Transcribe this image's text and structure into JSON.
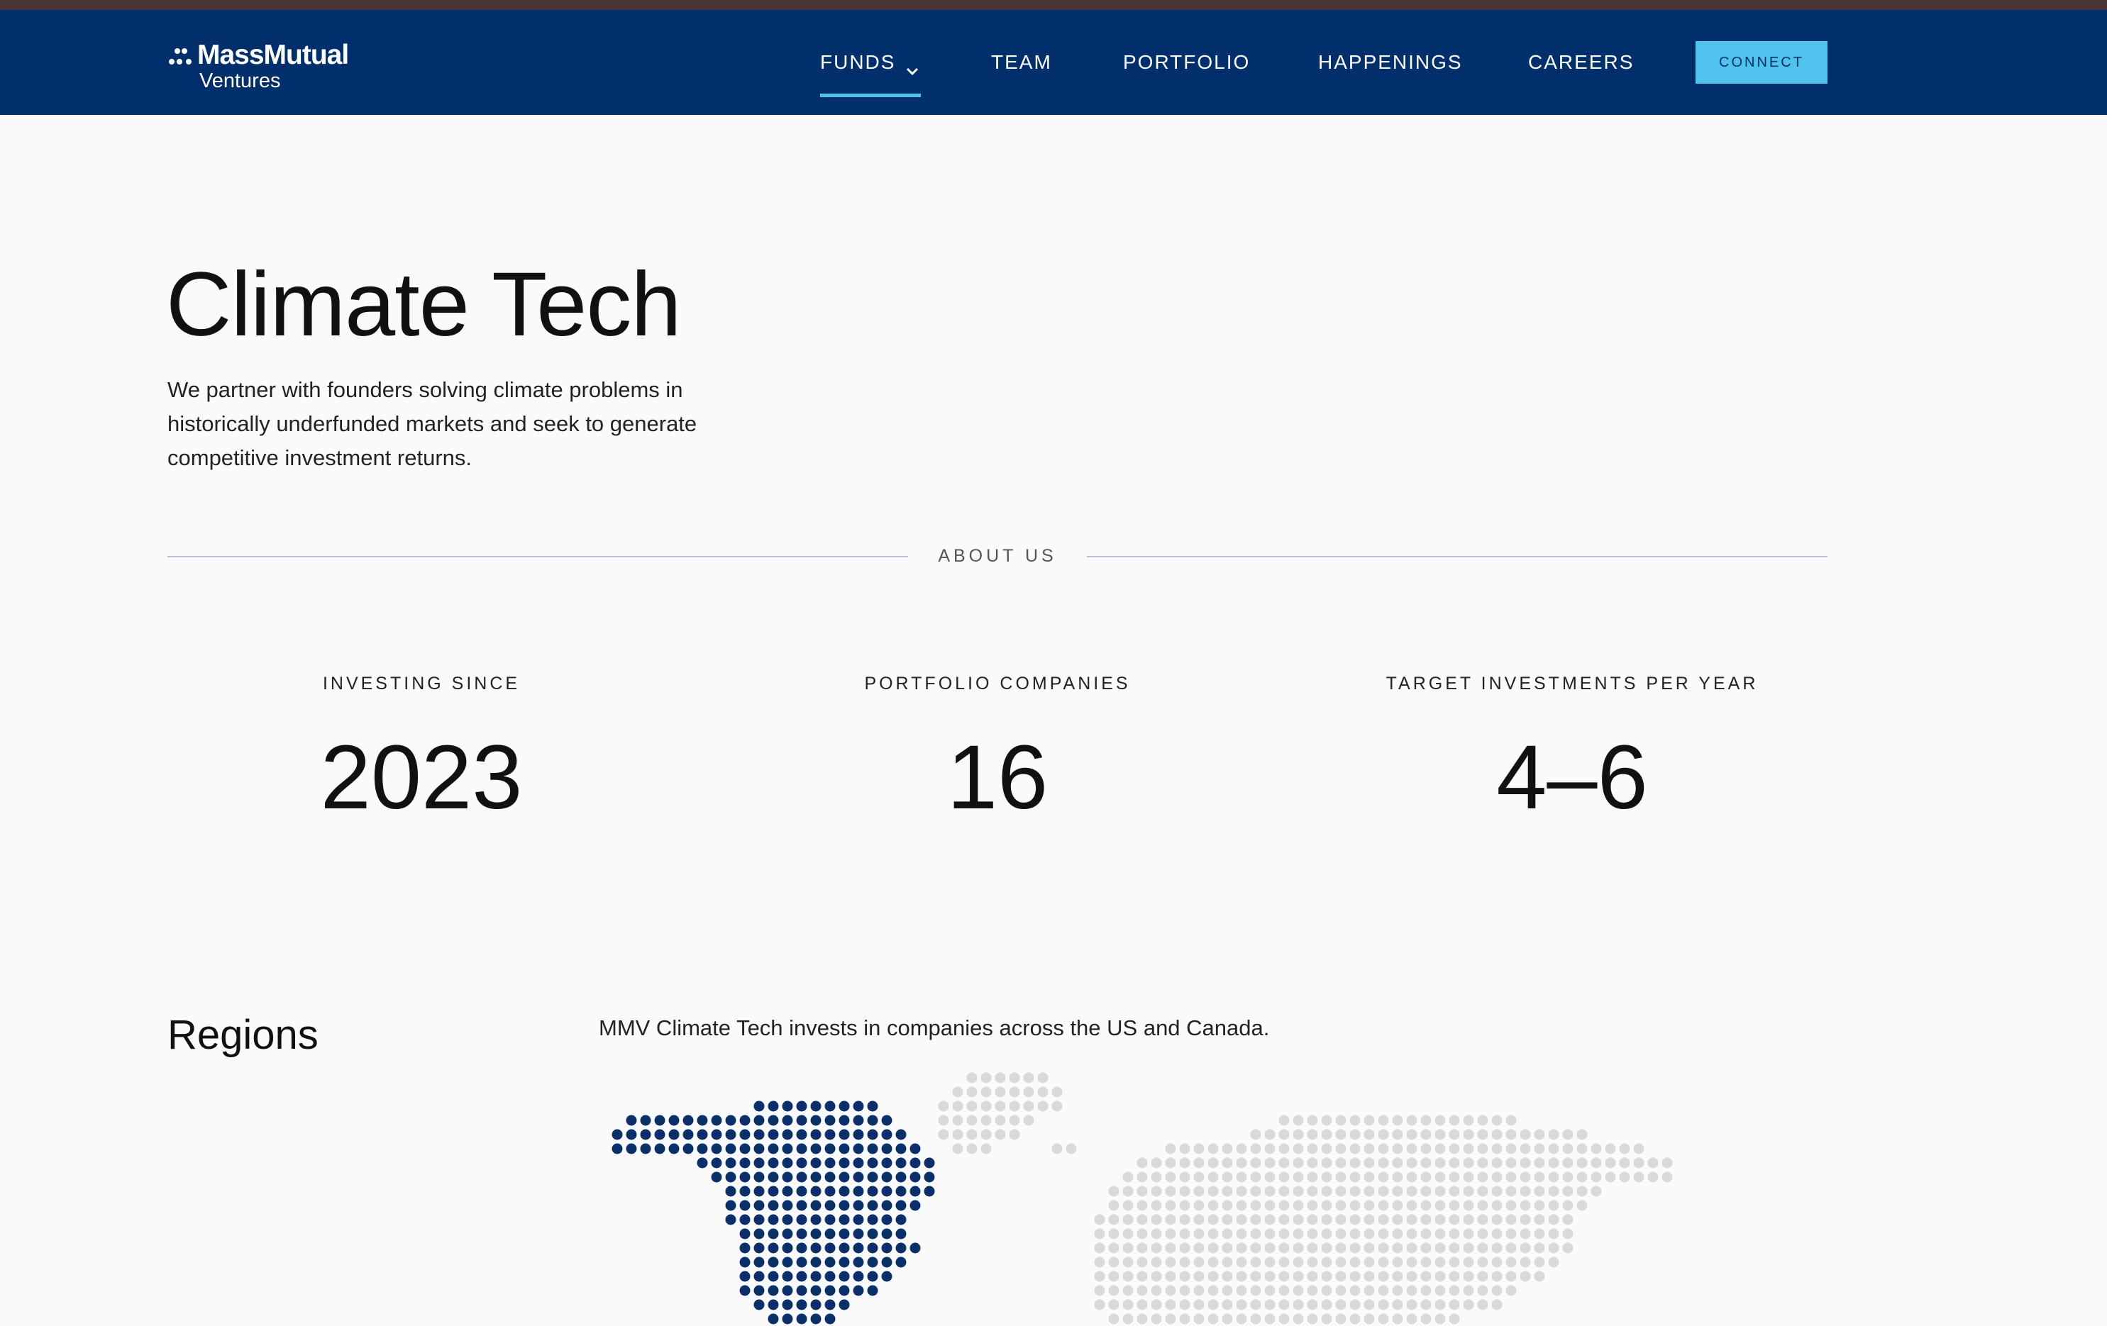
{
  "brand": {
    "name": "MassMutual",
    "subtitle": "Ventures"
  },
  "nav": {
    "items": [
      {
        "label": "FUNDS",
        "active": true,
        "has_dropdown": true
      },
      {
        "label": "TEAM"
      },
      {
        "label": "PORTFOLIO"
      },
      {
        "label": "HAPPENINGS"
      },
      {
        "label": "CAREERS"
      }
    ],
    "connect_label": "CONNECT"
  },
  "hero": {
    "title": "Climate Tech",
    "description": "We partner with founders solving climate problems in historically underfunded markets and seek to generate competitive investment returns."
  },
  "about": {
    "label": "ABOUT US",
    "stats": [
      {
        "label": "INVESTING SINCE",
        "value": "2023"
      },
      {
        "label": "PORTFOLIO COMPANIES",
        "value": "16"
      },
      {
        "label": "TARGET INVESTMENTS PER YEAR",
        "value": "4–6"
      }
    ]
  },
  "regions": {
    "title": "Regions",
    "description": "MMV Climate Tech invests in companies across the US and Canada."
  },
  "colors": {
    "nav_bg": "#002f6c",
    "accent": "#4fc3ee",
    "map_highlight": "#0b2f6b",
    "map_other": "#d9d9d9",
    "page_bg": "#fafafa"
  },
  "icons": {
    "logo": "three-dots-logo-icon",
    "funds_dropdown": "chevron-down-icon"
  }
}
